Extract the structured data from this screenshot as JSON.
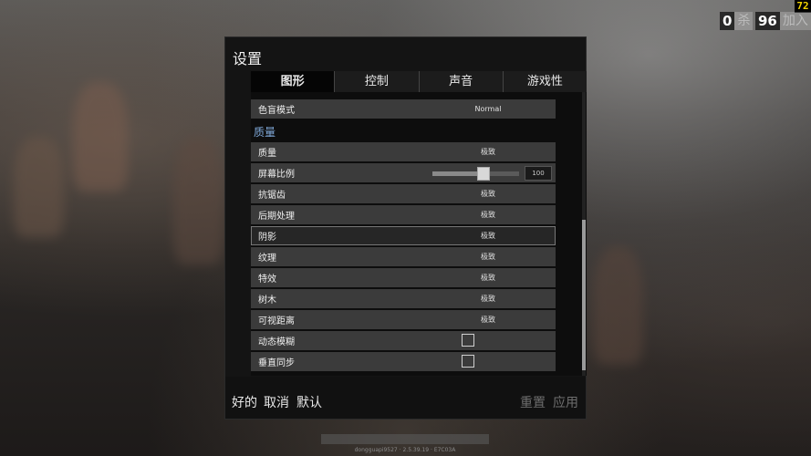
{
  "hud": {
    "fps": "72",
    "kills_count": "0",
    "kills_label": "杀",
    "joined_count": "96",
    "joined_label": "加入"
  },
  "settings": {
    "title": "设置",
    "tabs": [
      {
        "label": "图形",
        "active": true
      },
      {
        "label": "控制",
        "active": false
      },
      {
        "label": "声音",
        "active": false
      },
      {
        "label": "游戏性",
        "active": false
      }
    ],
    "colorblind": {
      "label": "色盲模式",
      "value": "Normal"
    },
    "section_quality": "质量",
    "rows": [
      {
        "label": "质量",
        "value": "极致"
      },
      {
        "label": "屏幕比例",
        "slider_value": "100",
        "slider_fraction": 0.59
      },
      {
        "label": "抗锯齿",
        "value": "极致"
      },
      {
        "label": "后期处理",
        "value": "极致"
      },
      {
        "label": "阴影",
        "value": "极致"
      },
      {
        "label": "纹理",
        "value": "极致"
      },
      {
        "label": "特效",
        "value": "极致"
      },
      {
        "label": "树木",
        "value": "极致"
      },
      {
        "label": "可视距离",
        "value": "极致"
      },
      {
        "label": "动态模糊",
        "checked": false
      },
      {
        "label": "垂直同步",
        "checked": false
      }
    ],
    "footer": {
      "ok": "好的",
      "cancel": "取消",
      "default": "默认",
      "reset": "重置",
      "apply": "应用"
    }
  },
  "version": "dongguapi9527 · 2.5.39.19 · E7C03A"
}
